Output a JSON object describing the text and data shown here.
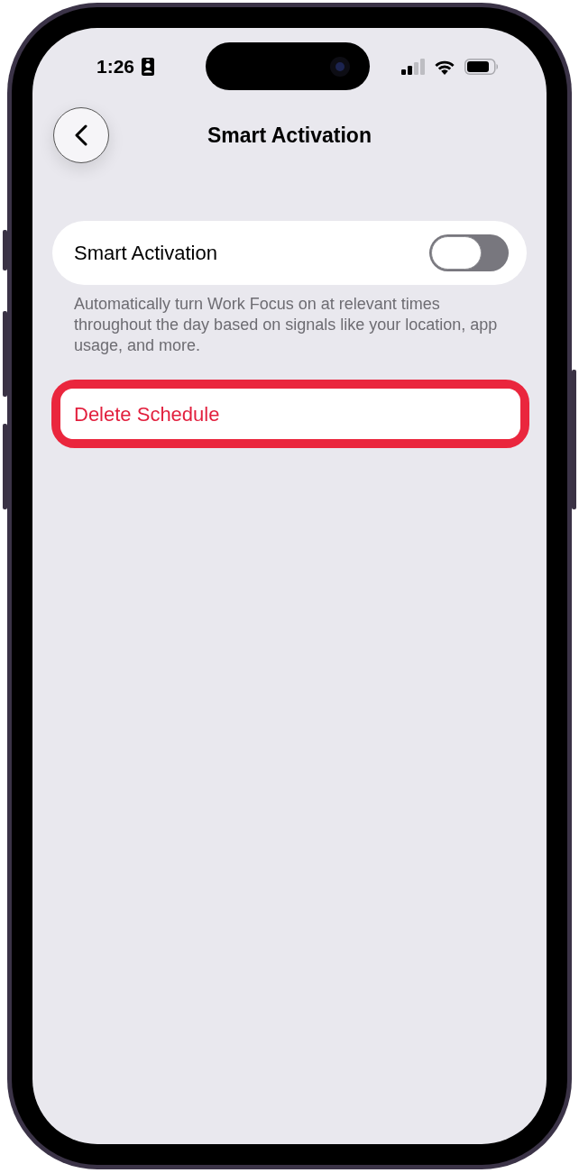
{
  "status_bar": {
    "time": "1:26"
  },
  "nav": {
    "title": "Smart Activation"
  },
  "smart_activation": {
    "label": "Smart Activation",
    "on": false
  },
  "description": "Automatically turn Work Focus on at relevant times throughout the day based on signals like your location, app usage, and more.",
  "delete_button": {
    "label": "Delete Schedule",
    "highlighted": true
  }
}
